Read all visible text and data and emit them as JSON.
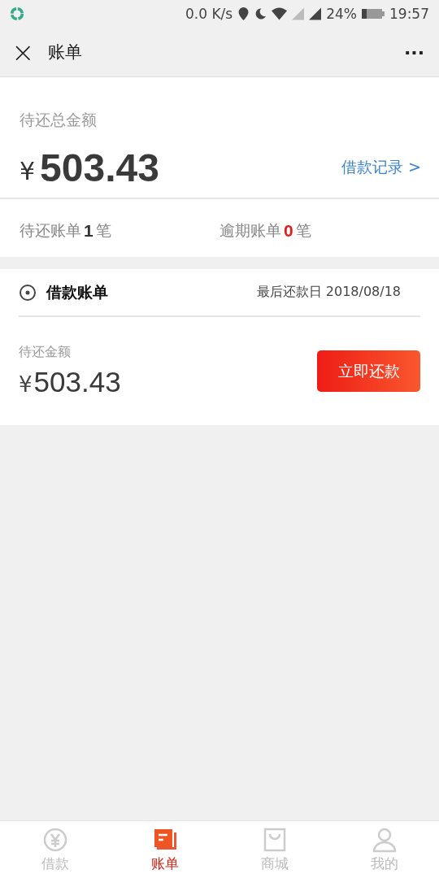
{
  "status_bar": {
    "speed": "0.0 K/s",
    "battery": "24%",
    "time": "19:57"
  },
  "header": {
    "close": "×",
    "title": "账单",
    "menu": "···"
  },
  "summary": {
    "label": "待还总金额",
    "currency": "¥",
    "amount": "503.43",
    "link": "借款记录 >",
    "stats": [
      {
        "kind": "pending",
        "label": "待还账单",
        "count": "1",
        "unit": "笔"
      },
      {
        "kind": "overdue",
        "label": "逾期账单",
        "count": "0",
        "unit": "笔"
      }
    ]
  },
  "bill": {
    "title": "借款账单",
    "due": "最后还款日 2018/08/18",
    "label": "待还金额",
    "currency": "¥",
    "amount": "503.43",
    "button": "立即还款"
  },
  "nav": [
    {
      "kind": "loan",
      "label": "借款",
      "selected": false
    },
    {
      "kind": "bill",
      "label": "账单",
      "selected": true
    },
    {
      "kind": "shop",
      "label": "商城",
      "selected": false
    },
    {
      "kind": "me",
      "label": "我的",
      "selected": false
    }
  ]
}
